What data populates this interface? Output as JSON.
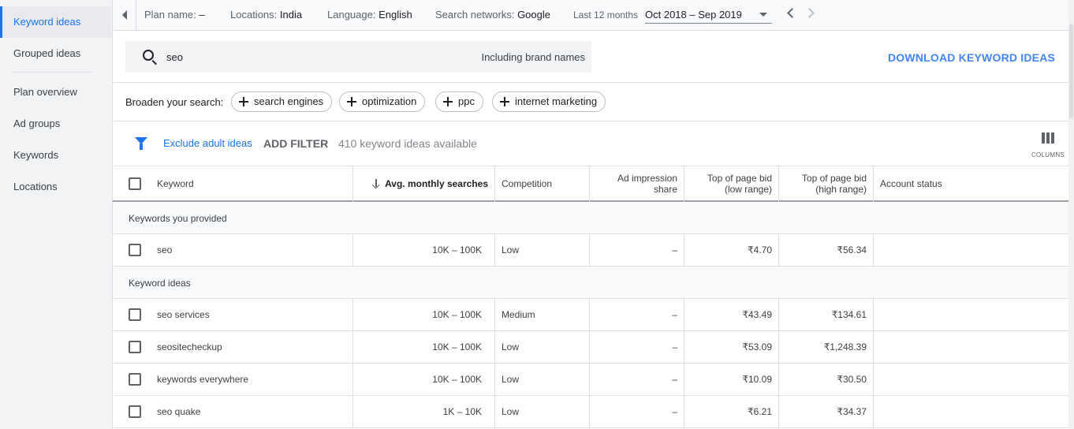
{
  "sidebar": {
    "items": [
      {
        "label": "Keyword ideas",
        "active": true
      },
      {
        "label": "Grouped ideas",
        "active": false
      },
      {
        "label": "Plan overview",
        "active": false
      },
      {
        "label": "Ad groups",
        "active": false
      },
      {
        "label": "Keywords",
        "active": false
      },
      {
        "label": "Locations",
        "active": false
      }
    ]
  },
  "topbar": {
    "plan_name_label": "Plan name:",
    "plan_name_value": "–",
    "locations_label": "Locations:",
    "locations_value": "India",
    "language_label": "Language:",
    "language_value": "English",
    "networks_label": "Search networks:",
    "networks_value": "Google",
    "period_label": "Last 12 months",
    "date_range": "Oct 2018 – Sep 2019"
  },
  "search": {
    "query": "seo",
    "brand_toggle": "Including brand names"
  },
  "download_label": "DOWNLOAD KEYWORD IDEAS",
  "broaden": {
    "label": "Broaden your search:",
    "chips": [
      "search engines",
      "optimization",
      "ppc",
      "internet marketing"
    ]
  },
  "filters": {
    "exclude_label": "Exclude adult ideas",
    "add_filter_label": "ADD FILTER",
    "count_text": "410 keyword ideas available",
    "columns_label": "COLUMNS"
  },
  "table": {
    "headers": {
      "keyword": "Keyword",
      "avg_searches": "Avg. monthly searches",
      "competition": "Competition",
      "ad_impression_1": "Ad impression",
      "ad_impression_2": "share",
      "top_low_1": "Top of page bid",
      "top_low_2": "(low range)",
      "top_high_1": "Top of page bid",
      "top_high_2": "(high range)",
      "account_status": "Account status"
    },
    "section_provided": "Keywords you provided",
    "section_ideas": "Keyword ideas",
    "provided_rows": [
      {
        "keyword": "seo",
        "searches": "10K – 100K",
        "competition": "Low",
        "impression": "–",
        "low": "₹4.70",
        "high": "₹56.34"
      }
    ],
    "idea_rows": [
      {
        "keyword": "seo services",
        "searches": "10K – 100K",
        "competition": "Medium",
        "impression": "–",
        "low": "₹43.49",
        "high": "₹134.61"
      },
      {
        "keyword": "seositecheckup",
        "searches": "10K – 100K",
        "competition": "Low",
        "impression": "–",
        "low": "₹53.09",
        "high": "₹1,248.39"
      },
      {
        "keyword": "keywords everywhere",
        "searches": "10K – 100K",
        "competition": "Low",
        "impression": "–",
        "low": "₹10.09",
        "high": "₹30.50"
      },
      {
        "keyword": "seo quake",
        "searches": "1K – 10K",
        "competition": "Low",
        "impression": "–",
        "low": "₹6.21",
        "high": "₹34.37"
      }
    ]
  }
}
